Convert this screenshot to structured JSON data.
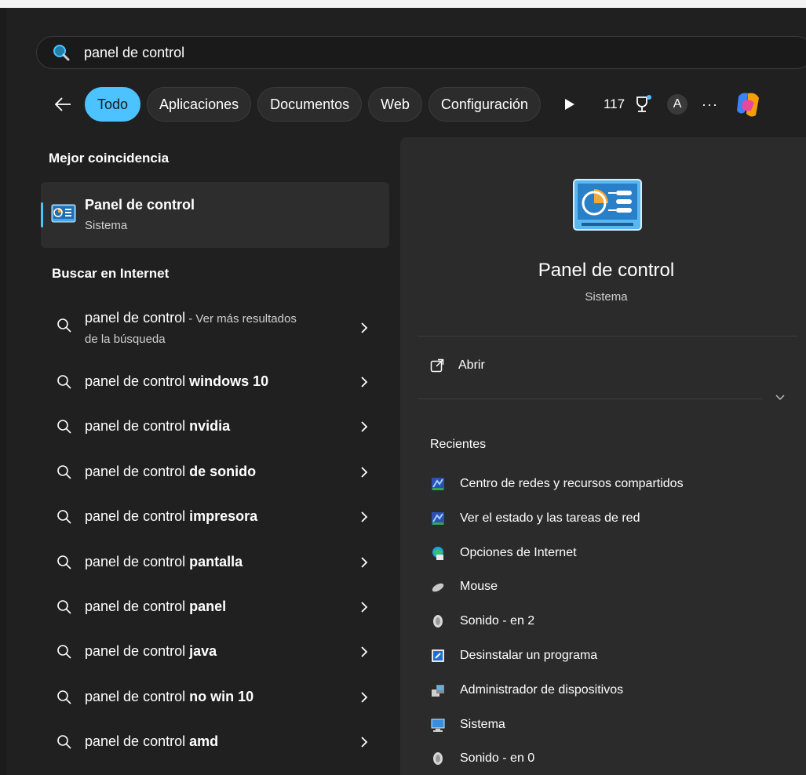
{
  "search": {
    "value": "panel de control",
    "icon": "search-icon"
  },
  "filters": {
    "chips": [
      "Todo",
      "Aplicaciones",
      "Documentos",
      "Web",
      "Configuración"
    ],
    "active": "Todo",
    "points": "117",
    "avatar_letter": "A",
    "more": "···"
  },
  "best_match": {
    "heading": "Mejor coincidencia",
    "name": "Panel de control",
    "kind": "Sistema"
  },
  "web": {
    "heading": "Buscar en Internet",
    "first": {
      "prefix": "panel de control",
      "suffix": " - Ver más resultados",
      "line2": "de la búsqueda"
    },
    "items": [
      {
        "prefix": "panel de control ",
        "bold": "windows 10"
      },
      {
        "prefix": "panel de control ",
        "bold": "nvidia"
      },
      {
        "prefix": "panel de control ",
        "bold": "de sonido"
      },
      {
        "prefix": "panel de control ",
        "bold": "impresora"
      },
      {
        "prefix": "panel de control ",
        "bold": "pantalla"
      },
      {
        "prefix": "panel de control ",
        "bold": "panel"
      },
      {
        "prefix": "panel de control ",
        "bold": "java"
      },
      {
        "prefix": "panel de control ",
        "bold": "no win 10"
      },
      {
        "prefix": "panel de control ",
        "bold": "amd"
      }
    ]
  },
  "preview": {
    "title": "Panel de control",
    "subtitle": "Sistema",
    "open_label": "Abrir",
    "recent_heading": "Recientes",
    "recent": [
      {
        "label": "Centro de redes y recursos compartidos",
        "icon": "network-icon"
      },
      {
        "label": "Ver el estado y las tareas de red",
        "icon": "network-icon"
      },
      {
        "label": "Opciones de Internet",
        "icon": "internet-options-icon"
      },
      {
        "label": "Mouse",
        "icon": "mouse-icon"
      },
      {
        "label": "Sonido - en 2",
        "icon": "speaker-icon"
      },
      {
        "label": "Desinstalar un programa",
        "icon": "uninstall-icon"
      },
      {
        "label": "Administrador de dispositivos",
        "icon": "device-manager-icon"
      },
      {
        "label": "Sistema",
        "icon": "system-icon"
      },
      {
        "label": "Sonido - en 0",
        "icon": "speaker-icon"
      }
    ]
  },
  "colors": {
    "accent": "#4cc2ff",
    "background": "#202020",
    "panel": "#2b2b2b"
  }
}
